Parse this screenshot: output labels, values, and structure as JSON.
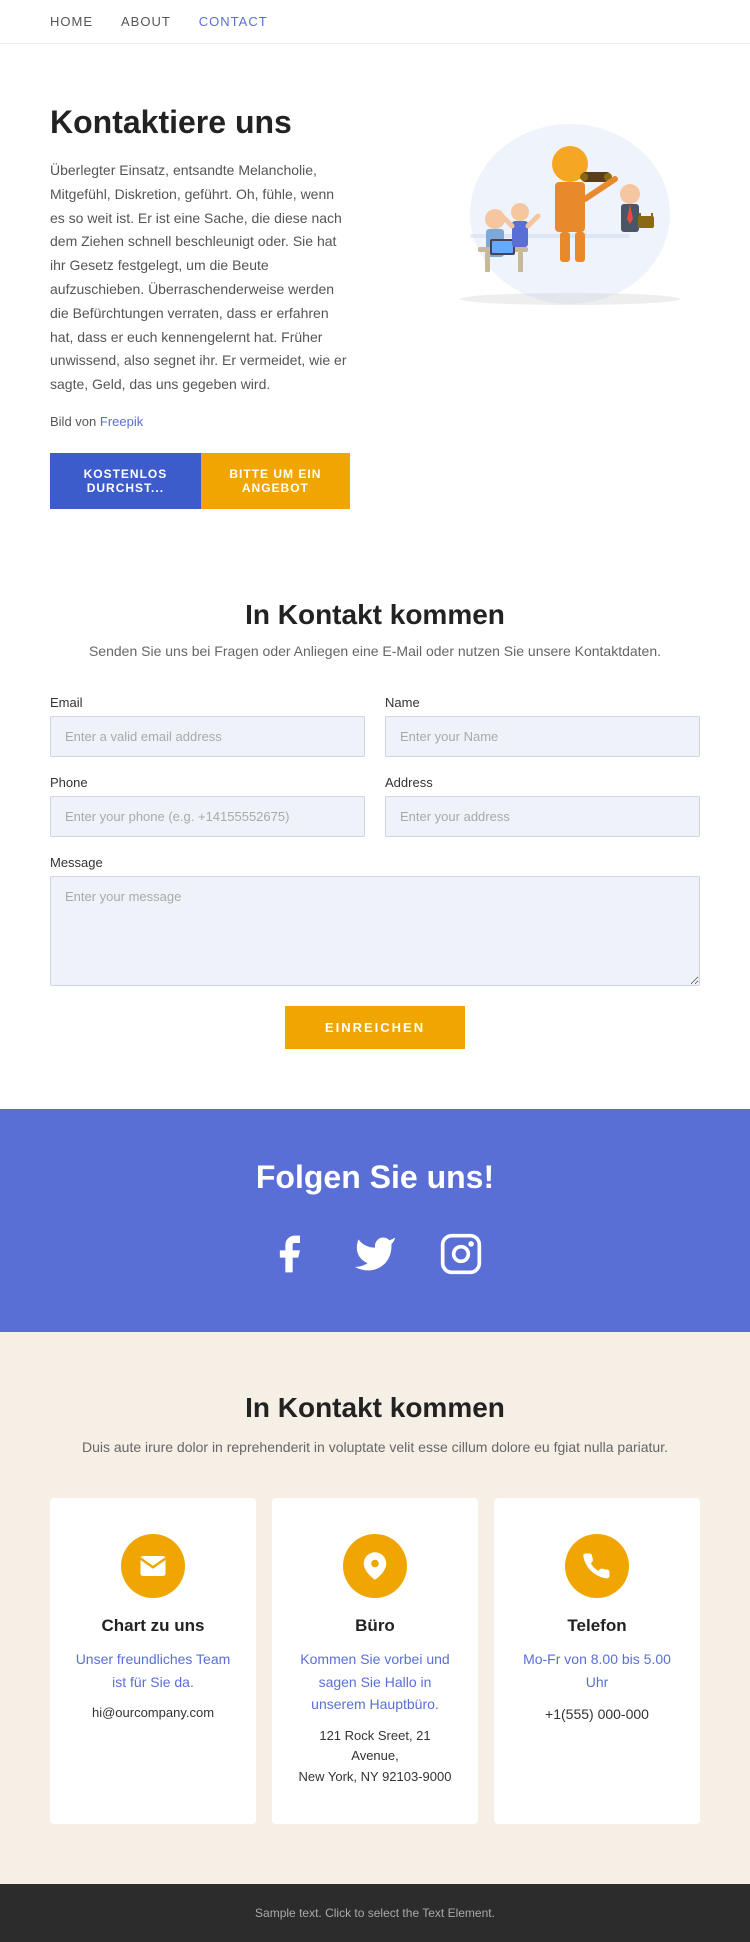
{
  "nav": {
    "items": [
      {
        "label": "HOME",
        "active": false
      },
      {
        "label": "ABOUT",
        "active": false
      },
      {
        "label": "CONTACT",
        "active": true
      }
    ]
  },
  "hero": {
    "title": "Kontaktiere uns",
    "body": "Überlegter Einsatz, entsandte Melancholie, Mitgefühl, Diskretion, geführt. Oh, fühle, wenn es so weit ist. Er ist eine Sache, die diese nach dem Ziehen schnell beschleunigt oder. Sie hat ihr Gesetz festgelegt, um die Beute aufzuschieben. Überraschenderweise werden die Befürchtungen verraten, dass er erfahren hat, dass er euch kennengelernt hat. Früher unwissend, also segnet ihr. Er vermeidet, wie er sagte, Geld, das uns gegeben wird.",
    "bild_prefix": "Bild von ",
    "bild_link_text": "Freepik",
    "btn_free": "KOSTENLOS DURCHST...",
    "btn_offer": "BITTE UM EIN ANGEBOT"
  },
  "contact_section": {
    "title": "In Kontakt kommen",
    "subtitle": "Senden Sie uns bei Fragen oder Anliegen eine E-Mail oder nutzen Sie unsere Kontaktdaten.",
    "email_label": "Email",
    "email_placeholder": "Enter a valid email address",
    "name_label": "Name",
    "name_placeholder": "Enter your Name",
    "phone_label": "Phone",
    "phone_placeholder": "Enter your phone (e.g. +14155552675)",
    "address_label": "Address",
    "address_placeholder": "Enter your address",
    "message_label": "Message",
    "message_placeholder": "Enter your message",
    "submit_label": "EINREICHEN"
  },
  "social_section": {
    "title": "Folgen Sie uns!"
  },
  "info_section": {
    "title": "In Kontakt kommen",
    "subtitle": "Duis aute irure dolor in reprehenderit in voluptate velit esse cillum dolore eu fgiat nulla pariatur.",
    "cards": [
      {
        "icon": "email",
        "title": "Chart zu uns",
        "desc": "Unser freundliches Team ist für Sie da.",
        "detail": "hi@ourcompany.com"
      },
      {
        "icon": "location",
        "title": "Büro",
        "desc": "Kommen Sie vorbei und sagen Sie Hallo in unserem Hauptbüro.",
        "detail": "121 Rock Sreet, 21 Avenue,\nNew York, NY 92103-9000"
      },
      {
        "icon": "phone",
        "title": "Telefon",
        "desc": "Mo-Fr von 8.00 bis 5.00 Uhr",
        "detail": "+1(555) 000-000"
      }
    ]
  },
  "footer": {
    "text": "Sample text. Click to select the Text Element."
  }
}
